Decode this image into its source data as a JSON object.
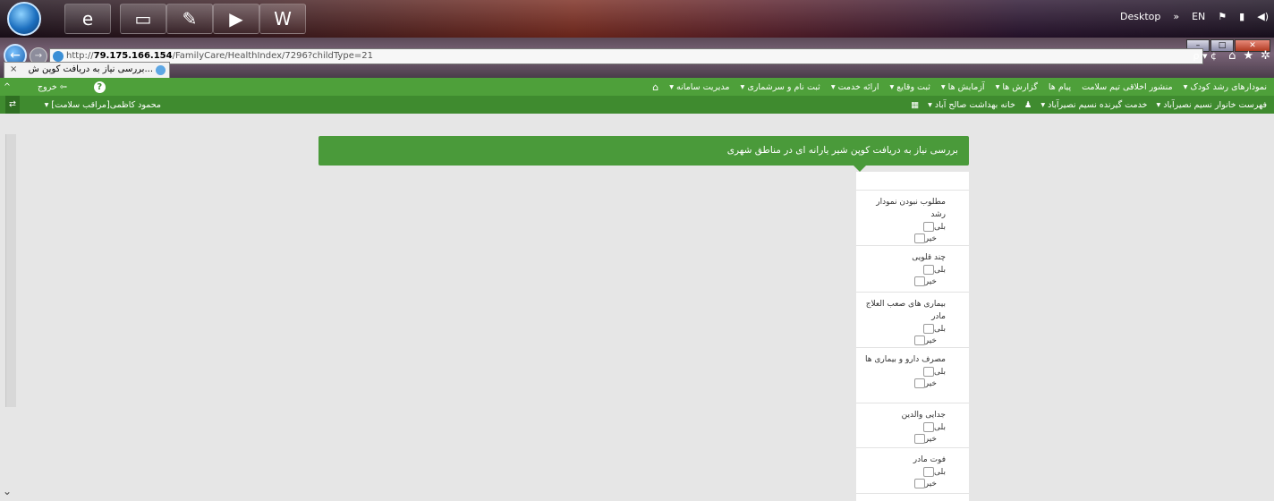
{
  "taskbar": {
    "apps": [
      "ie-icon",
      "folder-icon",
      "pdf-icon",
      "media-player-icon",
      "word-icon"
    ],
    "desktop_label": "Desktop",
    "chevron": "»",
    "lang": "EN"
  },
  "browser": {
    "url_prefix": "http://",
    "url_host": "79.175.166.154",
    "url_path": "/FamilyCare/HealthIndex/7296?childType=21",
    "addr_controls": "ρ ▾ ¢",
    "tab_title": "...بررسی نیاز به دریافت کوپن ش",
    "tab_close": "×"
  },
  "app": {
    "logout_label": "خروج",
    "menu": [
      "مدیریت سامانه ▾",
      "ثبت نام و سرشماری ▾",
      "ارائه خدمت ▾",
      "ثبت وقایع ▾",
      "آزمایش ها ▾",
      "گزارش ها ▾",
      "پیام ها",
      "منشور اخلاقی تیم سلامت",
      "نمودارهای رشد کودک ▾"
    ],
    "user_label": "محمود کاظمی[مراقب سلامت] ▾",
    "subnav": [
      "خانه بهداشت صالح آباد ▾",
      "خدمت گیرنده نسیم نصیرآباد ▾",
      "فهرست خانوار نسیم نصیرآباد ▾"
    ]
  },
  "form": {
    "title": "بررسی نیاز به دریافت کوپن شیر یارانه ای در مناطق شهری",
    "yes_label": "بلی",
    "no_label": "خیر",
    "questions": [
      "مطلوب نبودن نمودار رشد",
      "چند قلویی",
      "بیماری های صعب العلاج مادر",
      "مصرف دارو و بیماری ها",
      "جدایی والدین",
      "فوت مادر"
    ]
  }
}
